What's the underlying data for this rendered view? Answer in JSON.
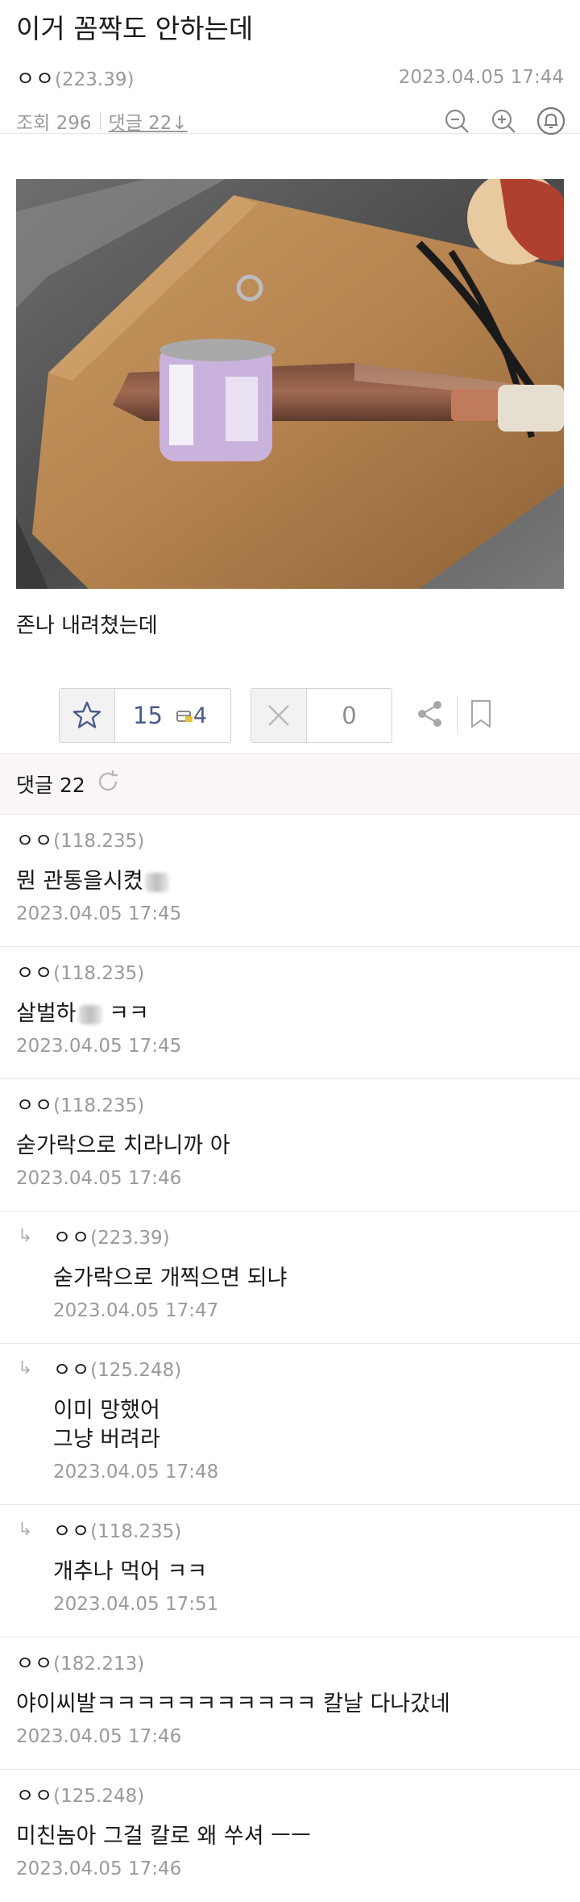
{
  "post": {
    "title": "이거 꼼짝도 안하는데",
    "author": "ㅇㅇ",
    "author_ip": "(223.39)",
    "datetime": "2023.04.05 17:44",
    "views_label": "조회 296",
    "comments_link": "댓글 22↓",
    "body": "존나 내려쳤는데"
  },
  "votes": {
    "up_count": "15",
    "mini_count": "4",
    "down_count": "0"
  },
  "comments_header": "댓글 22",
  "comments": [
    {
      "author": "ㅇㅇ",
      "ip": "(118.235)",
      "text": "뭔 관통을시켰",
      "time": "2023.04.05 17:45",
      "reply": false,
      "blur": true
    },
    {
      "author": "ㅇㅇ",
      "ip": "(118.235)",
      "text": "살벌하",
      "text2": "ㅋㅋ",
      "time": "2023.04.05 17:45",
      "reply": false,
      "blur": true
    },
    {
      "author": "ㅇㅇ",
      "ip": "(118.235)",
      "text": "숟가락으로 치라니까 아",
      "time": "2023.04.05 17:46",
      "reply": false
    },
    {
      "author": "ㅇㅇ",
      "ip": "(223.39)",
      "text": "숟가락으로 개찍으면 되냐",
      "time": "2023.04.05 17:47",
      "reply": true
    },
    {
      "author": "ㅇㅇ",
      "ip": "(125.248)",
      "text": "이미 망했어\n그냥 버려라",
      "time": "2023.04.05 17:48",
      "reply": true
    },
    {
      "author": "ㅇㅇ",
      "ip": "(118.235)",
      "text": "개추나 먹어 ㅋㅋ",
      "time": "2023.04.05 17:51",
      "reply": true
    },
    {
      "author": "ㅇㅇ",
      "ip": "(182.213)",
      "text": "야이씨발ㅋㅋㅋㅋㅋㅋㅋㅋㅋㅋㅋ 칼날 다나갔네",
      "time": "2023.04.05 17:46",
      "reply": false
    },
    {
      "author": "ㅇㅇ",
      "ip": "(125.248)",
      "text": "미친놈아 그걸 칼로 왜 쑤셔 ㅡㅡ",
      "time": "2023.04.05 17:46",
      "reply": false
    }
  ],
  "reply_arrow": "↳",
  "icons": {
    "zoom_out": "zoom-out-icon",
    "zoom_in": "zoom-in-icon",
    "alarm": "bell-icon",
    "star": "star-icon",
    "gift": "gift-icon",
    "x": "close-icon",
    "share": "share-icon",
    "bookmark": "bookmark-icon",
    "refresh": "refresh-icon"
  }
}
